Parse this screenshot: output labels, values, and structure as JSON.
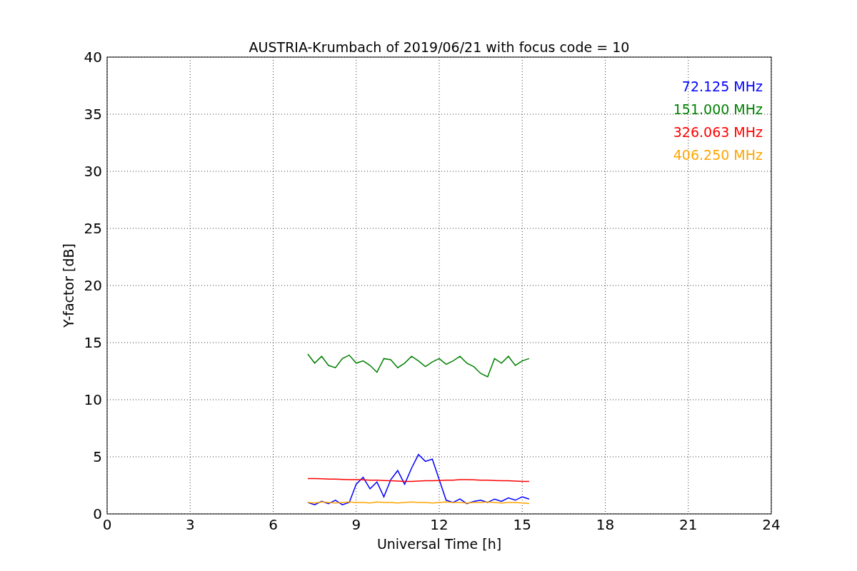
{
  "chart_data": {
    "type": "line",
    "title": "AUSTRIA-Krumbach of 2019/06/21 with focus code = 10",
    "xlabel": "Universal Time [h]",
    "ylabel": "Y-factor [dB]",
    "x": [
      7.25,
      7.5,
      7.75,
      8,
      8.25,
      8.5,
      8.75,
      9,
      9.25,
      9.5,
      9.75,
      10,
      10.25,
      10.5,
      10.75,
      11,
      11.25,
      11.5,
      11.75,
      12,
      12.25,
      12.5,
      12.75,
      13,
      13.25,
      13.5,
      13.75,
      14,
      14.25,
      14.5,
      14.75,
      15,
      15.25
    ],
    "series": [
      {
        "name": "72.125 MHz",
        "color": "#0000ff",
        "values": [
          1.0,
          0.8,
          1.1,
          0.9,
          1.2,
          0.8,
          1.0,
          2.6,
          3.2,
          2.2,
          2.8,
          1.5,
          3.0,
          3.8,
          2.6,
          4.0,
          5.2,
          4.6,
          4.8,
          3.0,
          1.2,
          1.0,
          1.3,
          0.9,
          1.1,
          1.2,
          1.0,
          1.3,
          1.1,
          1.4,
          1.2,
          1.5,
          1.3
        ]
      },
      {
        "name": "151.000 MHz",
        "color": "#008000",
        "values": [
          14,
          13.2,
          13.8,
          13.0,
          12.8,
          13.6,
          13.9,
          13.2,
          13.4,
          13.0,
          12.4,
          13.6,
          13.5,
          12.8,
          13.2,
          13.8,
          13.4,
          12.9,
          13.3,
          13.6,
          13.1,
          13.4,
          13.8,
          13.2,
          12.9,
          12.3,
          12.0,
          13.6,
          13.2,
          13.8,
          13.0,
          13.4,
          13.6
        ]
      },
      {
        "name": "326.063 MHz",
        "color": "#ff0000",
        "values": [
          3.1,
          3.1,
          3.08,
          3.05,
          3.05,
          3.02,
          3.0,
          3.0,
          2.98,
          2.95,
          2.95,
          2.92,
          2.9,
          2.88,
          2.85,
          2.85,
          2.88,
          2.9,
          2.9,
          2.92,
          2.95,
          2.95,
          3.0,
          3.0,
          2.98,
          2.95,
          2.95,
          2.92,
          2.9,
          2.9,
          2.88,
          2.85,
          2.85
        ]
      },
      {
        "name": "406.250 MHz",
        "color": "#ffa500",
        "values": [
          1.0,
          0.95,
          1.05,
          1.0,
          0.95,
          1.0,
          1.05,
          1.0,
          1.0,
          0.95,
          1.05,
          1.0,
          1.0,
          0.95,
          1.0,
          1.05,
          1.0,
          1.0,
          0.95,
          1.0,
          1.05,
          1.0,
          1.0,
          0.95,
          1.0,
          1.0,
          1.05,
          1.0,
          0.95,
          1.0,
          1.0,
          0.95,
          0.9
        ]
      }
    ],
    "xlim": [
      0,
      24
    ],
    "ylim": [
      0,
      40
    ],
    "xticks": [
      0,
      3,
      6,
      9,
      12,
      15,
      18,
      21,
      24
    ],
    "yticks": [
      0,
      5,
      10,
      15,
      20,
      25,
      30,
      35,
      40
    ],
    "grid": true
  }
}
